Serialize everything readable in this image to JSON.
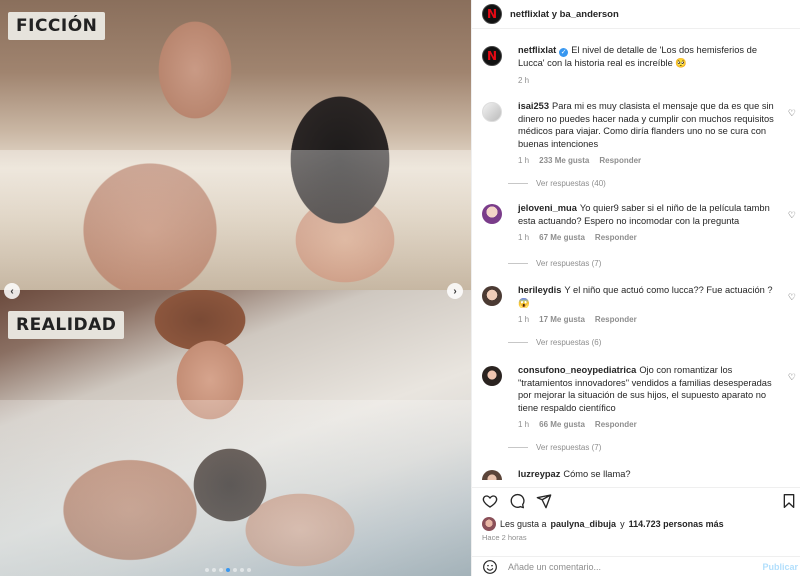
{
  "media": {
    "top_label": "FICCIÓN",
    "bottom_label": "REALIDAD",
    "prev_icon": "‹",
    "next_icon": "›",
    "dots": [
      false,
      false,
      false,
      true,
      false,
      false,
      false
    ]
  },
  "header": {
    "names": "netflixlat y ba_anderson"
  },
  "caption": {
    "user": "netflixlat",
    "text": "El nivel de detalle de 'Los dos hemisferios de Lucca' con la historia real es increíble 🥺",
    "time": "2 h"
  },
  "comments": [
    {
      "user": "isai253",
      "text": "Para mi es muy clasista el mensaje que da es que sin dinero no puedes hacer nada y cumplir con muchos requisitos médicos para viajar. Como diría flanders uno no se cura con buenas intenciones",
      "time": "1 h",
      "likes": "233 Me gusta",
      "reply": "Responder",
      "view_replies": "Ver respuestas (40)"
    },
    {
      "user": "jeloveni_mua",
      "text": "Yo quier9 saber si el niño de la película tambn esta actuando? Espero no incomodar con la pregunta",
      "time": "1 h",
      "likes": "67 Me gusta",
      "reply": "Responder",
      "view_replies": "Ver respuestas (7)"
    },
    {
      "user": "herileydis",
      "text": "Y el niño que actuó como lucca?? Fue actuación ? 😱",
      "time": "1 h",
      "likes": "17 Me gusta",
      "reply": "Responder",
      "view_replies": "Ver respuestas (6)"
    },
    {
      "user": "consufono_neoypediatrica",
      "text": "Ojo con romantizar los \"tratamientos innovadores\" vendidos a familias desesperadas por mejorar la situación de sus hijos, el supuesto aparato no tiene respaldo científico",
      "time": "1 h",
      "likes": "66 Me gusta",
      "reply": "Responder",
      "view_replies": "Ver respuestas (7)"
    },
    {
      "user": "luzreypaz",
      "text": "Cómo se llama?"
    }
  ],
  "likes_line": {
    "prefix": "Les gusta a",
    "user": "paulyna_dibuja",
    "middle": "y",
    "count": "114.723 personas más"
  },
  "timestamp": "Hace 2 horas",
  "add_comment": {
    "placeholder": "Añade un comentario...",
    "post_label": "Publicar"
  },
  "colors": {
    "link_blue": "#3897f0",
    "netflix_red": "#e50914"
  }
}
